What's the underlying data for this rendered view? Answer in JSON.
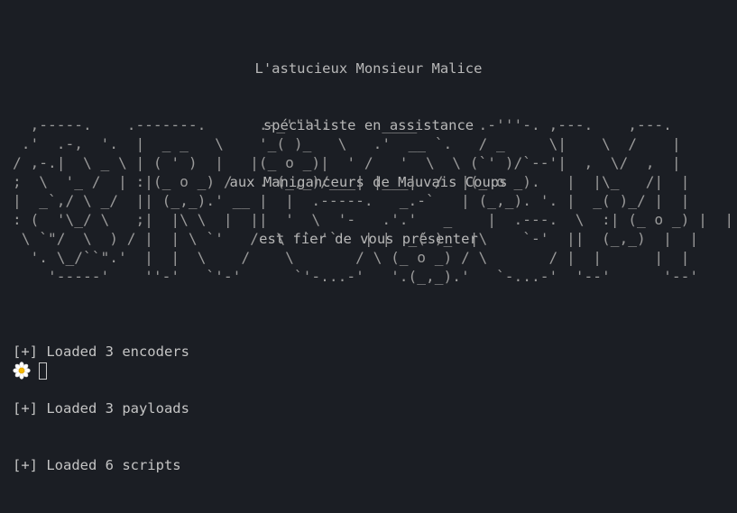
{
  "intro": {
    "line1": "L'astucieux Monsieur Malice",
    "line2": "spécialiste en assistance",
    "line3": "aux Maniganceurs de Mauvais Coups",
    "line4": "est fier de vous présenter"
  },
  "banner": {
    "art": "  ,-----.    .-------.      .-_'''-.      ____       .-'''-. ,---.    ,---.\n .'  .-,  '.  |  _ _   \\    '_( )_   \\   .'  __ `.   / _     \\|    \\  /    |\n/ ,-.|  \\ _ \\ | ( ' )  |   |(_ o _)|  ' /   '  \\  \\ (`' )/`--'|  ,  \\/  ,  |\n;  \\  '_ /  | :|(_ o _) /   . (_,_)/___| |___|  /  |(_ o _).   |  |\\_   /|  |\n|  _`,/ \\ _/  || (_,_).' __ |  |  .-----.   _.-`   | (_,_). '. |  _( )_/ |  |\n: (  '\\_/ \\   ;|  |\\ \\  |  ||  '  \\  '-   .'.'   _    |  .---.  \\  :| (_ o _) |  |\n \\ `\"/  \\  ) / |  | \\ `'   /  \\  `-'`   | |  _( )_  |\\    `-'  ||  (_,_)  |  |\n  '. \\_/``\".'  |  |  \\    /    \\       / \\ (_ o _) / \\       / |  |      |  |\n    '-----'    ''-'   `'-'      `'-...-'   '.(_,_).'   `-...-'  '--'      '--'"
  },
  "log": {
    "line1": "[+] Loaded 3 encoders",
    "line2": "[+] Loaded 3 payloads",
    "line3": "[+] Loaded 6 scripts"
  },
  "prompt": {
    "icon": "daisy-flower-icon"
  },
  "colors": {
    "background": "#1b1e24",
    "text": "#c8c8c8",
    "banner": "#9a9a9a"
  }
}
